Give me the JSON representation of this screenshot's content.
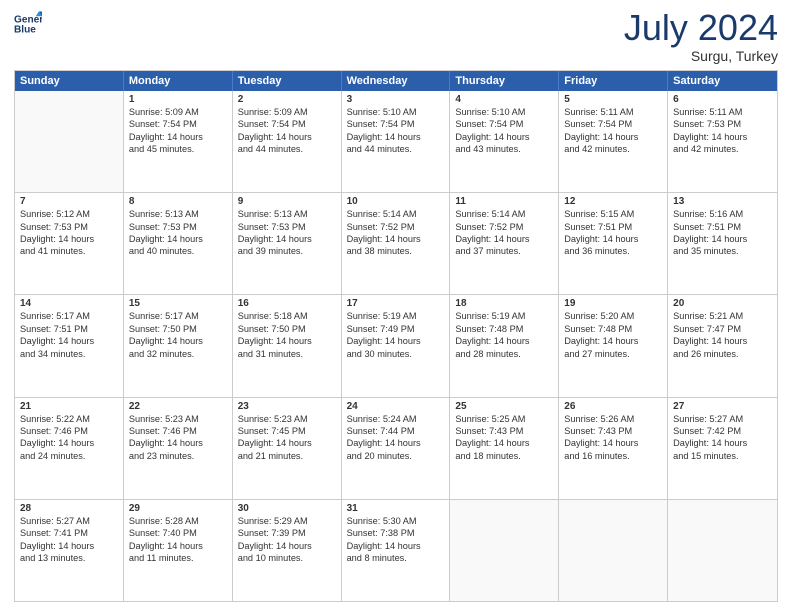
{
  "header": {
    "logo_line1": "General",
    "logo_line2": "Blue",
    "month": "July 2024",
    "location": "Surgu, Turkey"
  },
  "days_of_week": [
    "Sunday",
    "Monday",
    "Tuesday",
    "Wednesday",
    "Thursday",
    "Friday",
    "Saturday"
  ],
  "rows": [
    [
      {
        "day": "",
        "lines": []
      },
      {
        "day": "1",
        "lines": [
          "Sunrise: 5:09 AM",
          "Sunset: 7:54 PM",
          "Daylight: 14 hours",
          "and 45 minutes."
        ]
      },
      {
        "day": "2",
        "lines": [
          "Sunrise: 5:09 AM",
          "Sunset: 7:54 PM",
          "Daylight: 14 hours",
          "and 44 minutes."
        ]
      },
      {
        "day": "3",
        "lines": [
          "Sunrise: 5:10 AM",
          "Sunset: 7:54 PM",
          "Daylight: 14 hours",
          "and 44 minutes."
        ]
      },
      {
        "day": "4",
        "lines": [
          "Sunrise: 5:10 AM",
          "Sunset: 7:54 PM",
          "Daylight: 14 hours",
          "and 43 minutes."
        ]
      },
      {
        "day": "5",
        "lines": [
          "Sunrise: 5:11 AM",
          "Sunset: 7:54 PM",
          "Daylight: 14 hours",
          "and 42 minutes."
        ]
      },
      {
        "day": "6",
        "lines": [
          "Sunrise: 5:11 AM",
          "Sunset: 7:53 PM",
          "Daylight: 14 hours",
          "and 42 minutes."
        ]
      }
    ],
    [
      {
        "day": "7",
        "lines": [
          "Sunrise: 5:12 AM",
          "Sunset: 7:53 PM",
          "Daylight: 14 hours",
          "and 41 minutes."
        ]
      },
      {
        "day": "8",
        "lines": [
          "Sunrise: 5:13 AM",
          "Sunset: 7:53 PM",
          "Daylight: 14 hours",
          "and 40 minutes."
        ]
      },
      {
        "day": "9",
        "lines": [
          "Sunrise: 5:13 AM",
          "Sunset: 7:53 PM",
          "Daylight: 14 hours",
          "and 39 minutes."
        ]
      },
      {
        "day": "10",
        "lines": [
          "Sunrise: 5:14 AM",
          "Sunset: 7:52 PM",
          "Daylight: 14 hours",
          "and 38 minutes."
        ]
      },
      {
        "day": "11",
        "lines": [
          "Sunrise: 5:14 AM",
          "Sunset: 7:52 PM",
          "Daylight: 14 hours",
          "and 37 minutes."
        ]
      },
      {
        "day": "12",
        "lines": [
          "Sunrise: 5:15 AM",
          "Sunset: 7:51 PM",
          "Daylight: 14 hours",
          "and 36 minutes."
        ]
      },
      {
        "day": "13",
        "lines": [
          "Sunrise: 5:16 AM",
          "Sunset: 7:51 PM",
          "Daylight: 14 hours",
          "and 35 minutes."
        ]
      }
    ],
    [
      {
        "day": "14",
        "lines": [
          "Sunrise: 5:17 AM",
          "Sunset: 7:51 PM",
          "Daylight: 14 hours",
          "and 34 minutes."
        ]
      },
      {
        "day": "15",
        "lines": [
          "Sunrise: 5:17 AM",
          "Sunset: 7:50 PM",
          "Daylight: 14 hours",
          "and 32 minutes."
        ]
      },
      {
        "day": "16",
        "lines": [
          "Sunrise: 5:18 AM",
          "Sunset: 7:50 PM",
          "Daylight: 14 hours",
          "and 31 minutes."
        ]
      },
      {
        "day": "17",
        "lines": [
          "Sunrise: 5:19 AM",
          "Sunset: 7:49 PM",
          "Daylight: 14 hours",
          "and 30 minutes."
        ]
      },
      {
        "day": "18",
        "lines": [
          "Sunrise: 5:19 AM",
          "Sunset: 7:48 PM",
          "Daylight: 14 hours",
          "and 28 minutes."
        ]
      },
      {
        "day": "19",
        "lines": [
          "Sunrise: 5:20 AM",
          "Sunset: 7:48 PM",
          "Daylight: 14 hours",
          "and 27 minutes."
        ]
      },
      {
        "day": "20",
        "lines": [
          "Sunrise: 5:21 AM",
          "Sunset: 7:47 PM",
          "Daylight: 14 hours",
          "and 26 minutes."
        ]
      }
    ],
    [
      {
        "day": "21",
        "lines": [
          "Sunrise: 5:22 AM",
          "Sunset: 7:46 PM",
          "Daylight: 14 hours",
          "and 24 minutes."
        ]
      },
      {
        "day": "22",
        "lines": [
          "Sunrise: 5:23 AM",
          "Sunset: 7:46 PM",
          "Daylight: 14 hours",
          "and 23 minutes."
        ]
      },
      {
        "day": "23",
        "lines": [
          "Sunrise: 5:23 AM",
          "Sunset: 7:45 PM",
          "Daylight: 14 hours",
          "and 21 minutes."
        ]
      },
      {
        "day": "24",
        "lines": [
          "Sunrise: 5:24 AM",
          "Sunset: 7:44 PM",
          "Daylight: 14 hours",
          "and 20 minutes."
        ]
      },
      {
        "day": "25",
        "lines": [
          "Sunrise: 5:25 AM",
          "Sunset: 7:43 PM",
          "Daylight: 14 hours",
          "and 18 minutes."
        ]
      },
      {
        "day": "26",
        "lines": [
          "Sunrise: 5:26 AM",
          "Sunset: 7:43 PM",
          "Daylight: 14 hours",
          "and 16 minutes."
        ]
      },
      {
        "day": "27",
        "lines": [
          "Sunrise: 5:27 AM",
          "Sunset: 7:42 PM",
          "Daylight: 14 hours",
          "and 15 minutes."
        ]
      }
    ],
    [
      {
        "day": "28",
        "lines": [
          "Sunrise: 5:27 AM",
          "Sunset: 7:41 PM",
          "Daylight: 14 hours",
          "and 13 minutes."
        ]
      },
      {
        "day": "29",
        "lines": [
          "Sunrise: 5:28 AM",
          "Sunset: 7:40 PM",
          "Daylight: 14 hours",
          "and 11 minutes."
        ]
      },
      {
        "day": "30",
        "lines": [
          "Sunrise: 5:29 AM",
          "Sunset: 7:39 PM",
          "Daylight: 14 hours",
          "and 10 minutes."
        ]
      },
      {
        "day": "31",
        "lines": [
          "Sunrise: 5:30 AM",
          "Sunset: 7:38 PM",
          "Daylight: 14 hours",
          "and 8 minutes."
        ]
      },
      {
        "day": "",
        "lines": []
      },
      {
        "day": "",
        "lines": []
      },
      {
        "day": "",
        "lines": []
      }
    ]
  ]
}
